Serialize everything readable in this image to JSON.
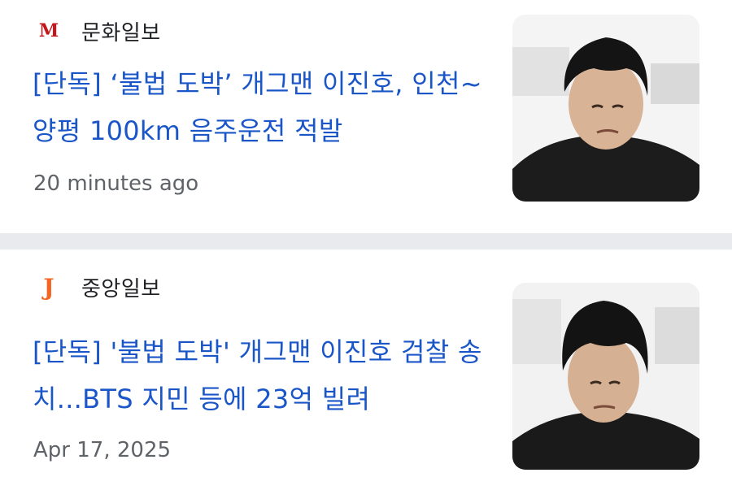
{
  "articles": [
    {
      "source_name": "문화일보",
      "logo_letter": "M",
      "logo_color": "#c4161c",
      "headline": "[단독] ‘불법 도박’ 개그맨 이진호, 인천~양평 100km 음주운전 적발",
      "time": "20 minutes ago",
      "thumbnail_icon": "man-portrait-photo"
    },
    {
      "source_name": "중앙일보",
      "logo_letter": "J",
      "logo_color": "#f26522",
      "headline": "[단독] '불법 도박' 개그맨 이진호 검찰 송치...BTS 지민 등에 23억 빌려",
      "time": "Apr 17, 2025",
      "thumbnail_icon": "man-portrait-photo"
    }
  ],
  "colors": {
    "headline": "#1a56c8",
    "divider": "#e8eaed",
    "meta_text": "#5f6368"
  }
}
